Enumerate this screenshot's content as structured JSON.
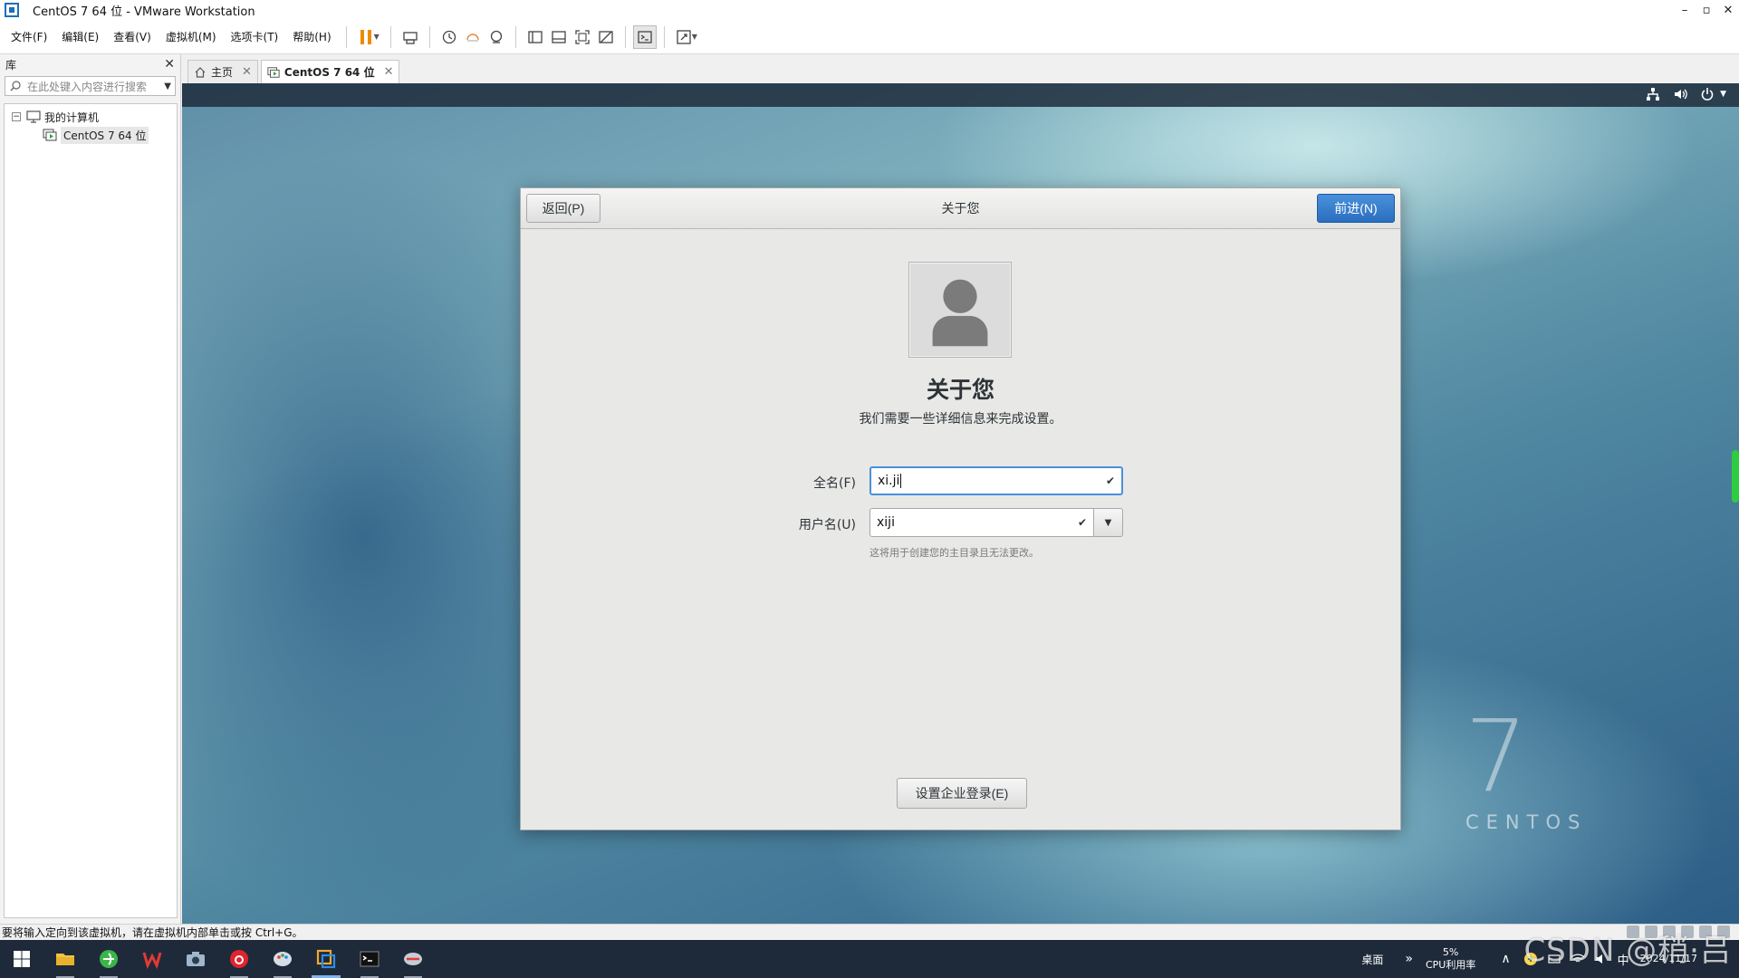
{
  "window": {
    "title": "CentOS 7 64 位 - VMware Workstation",
    "minimize": "–",
    "maximize": "▫",
    "close": "✕"
  },
  "menu": [
    "文件(F)",
    "编辑(E)",
    "查看(V)",
    "虚拟机(M)",
    "选项卡(T)",
    "帮助(H)"
  ],
  "library": {
    "title": "库",
    "close": "✕",
    "search_placeholder": "在此处键入内容进行搜索",
    "tree_root": "我的计算机",
    "tree_toggle": "⊟",
    "tree_child": "CentOS 7 64 位"
  },
  "tabs": [
    {
      "label": "主页",
      "close": "✕"
    },
    {
      "label": "CentOS 7 64 位",
      "close": "✕"
    }
  ],
  "dialog": {
    "back_label": "返回(P)",
    "title": "关于您",
    "next_label": "前进(N)",
    "heading": "关于您",
    "subheading": "我们需要一些详细信息来完成设置。",
    "fullname_label": "全名(F)",
    "fullname_value": "xi.ji",
    "username_label": "用户名(U)",
    "username_value": "xiji",
    "username_hint": "这将用于创建您的主目录且无法更改。",
    "enterprise_label": "设置企业登录(E)",
    "check": "✔",
    "combo_arrow": "▼"
  },
  "wallpaper": {
    "seven": "7",
    "word": "CENTOS"
  },
  "status": {
    "message": "要将输入定向到该虚拟机，请在虚拟机内部单击或按 Ctrl+G。"
  },
  "taskbar": {
    "desktop": "桌面",
    "chevron": "»",
    "cpu_percent": "5%",
    "cpu_label": "CPU利用率",
    "tray_up": "∧",
    "ime": "中",
    "time": "",
    "date": "2024/11/17"
  },
  "watermark": "CSDN @稍·吕",
  "colors": {
    "accent": "#4a90d9",
    "pause": "#f08a00",
    "taskbar": "#1e2a3a"
  }
}
